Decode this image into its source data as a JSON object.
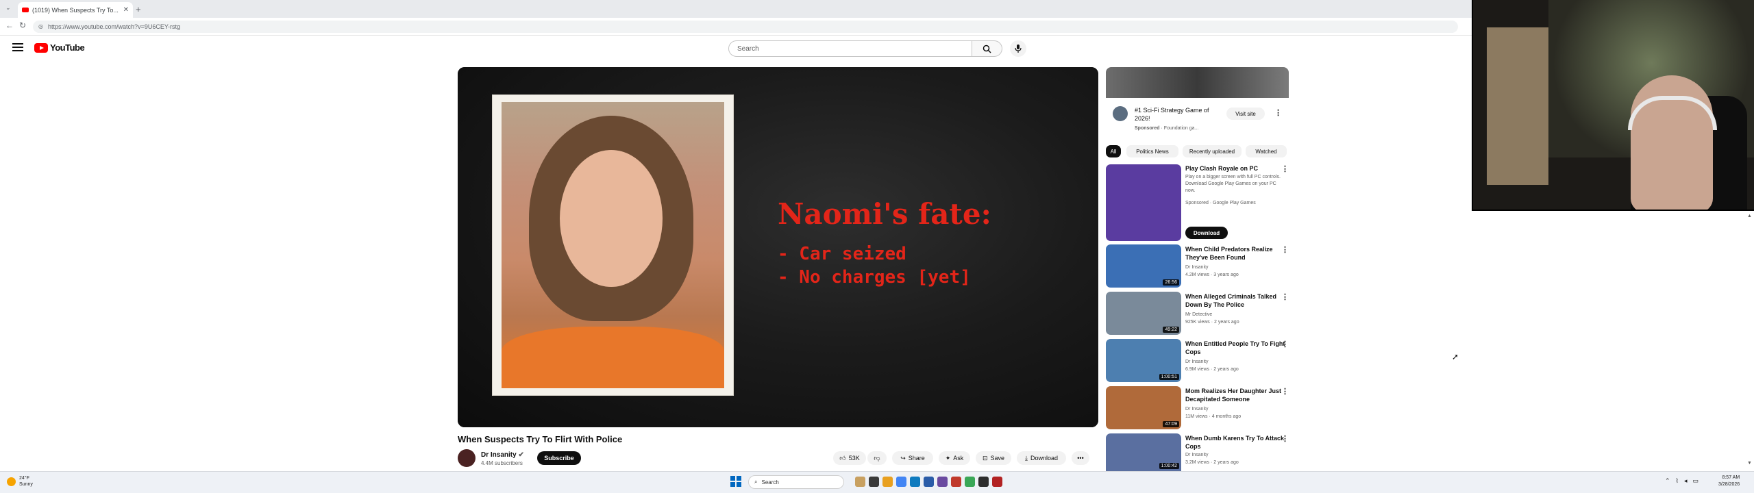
{
  "browser": {
    "tab_title": "(1019) When Suspects Try To...",
    "new_tab": "+",
    "url": "https://www.youtube.com/watch?v=9U6CEY-rstg"
  },
  "masthead": {
    "logo_text": "YouTube",
    "search_placeholder": "Search"
  },
  "video": {
    "overlay_title": "Naomi's fate:",
    "overlay_lines": [
      "- Car seized",
      "- No charges [yet]"
    ],
    "title": "When Suspects Try To Flirt With Police",
    "channel": "Dr Insanity",
    "subscribers": "4.4M subscribers",
    "subscribe_label": "Subscribe",
    "likes": "53K",
    "share_label": "Share",
    "ask_label": "Ask",
    "save_label": "Save",
    "download_label": "Download"
  },
  "ad": {
    "title": "#1 Sci-Fi Strategy Game of 2026!",
    "sponsored": "Sponsored",
    "advertiser": "Foundation ga...",
    "visit_label": "Visit site"
  },
  "chips": [
    "All",
    "Politics News",
    "Recently uploaded",
    "Watched"
  ],
  "recommendations": [
    {
      "title": "Play Clash Royale on PC",
      "desc": "Play on a bigger screen with full PC controls. Download Google Play Games on your PC now.",
      "meta1": "Sponsored · Google Play Games",
      "button": "Download",
      "thumb_color": "#5a3ca0"
    },
    {
      "title": "When Child Predators Realize They've Been Found",
      "meta1": "Dr Insanity",
      "meta2": "4.2M views · 3 years ago",
      "duration": "26:56",
      "thumb_color": "#3b6fb5"
    },
    {
      "title": "When Alleged Criminals Talked Down By The Police",
      "meta1": "Mr Detective",
      "meta2": "925K views · 2 years ago",
      "duration": "49:22",
      "thumb_color": "#7a8a9a"
    },
    {
      "title": "When Entitled People Try To Fight Cops",
      "meta1": "Dr Insanity",
      "meta2": "6.9M views · 2 years ago",
      "duration": "1:00:51",
      "thumb_color": "#4d7fb0"
    },
    {
      "title": "Mom Realizes Her Daughter Just Decapitated Someone",
      "meta1": "Dr Insanity",
      "meta2": "11M views · 4 months ago",
      "duration": "47:09",
      "thumb_color": "#b06a3a"
    },
    {
      "title": "When Dumb Karens Try To Attack Cops",
      "meta1": "Dr Insanity",
      "meta2": "3.2M views · 2 years ago",
      "duration": "1:00:42",
      "thumb_color": "#5a6fa0"
    }
  ],
  "taskbar": {
    "temp": "24°F",
    "condition": "Sunny",
    "search_label": "Search",
    "time": "8:57 AM",
    "date": "3/28/2026"
  },
  "icons": {
    "search": "search-icon",
    "mic": "microphone-icon",
    "menu": "hamburger-icon"
  }
}
